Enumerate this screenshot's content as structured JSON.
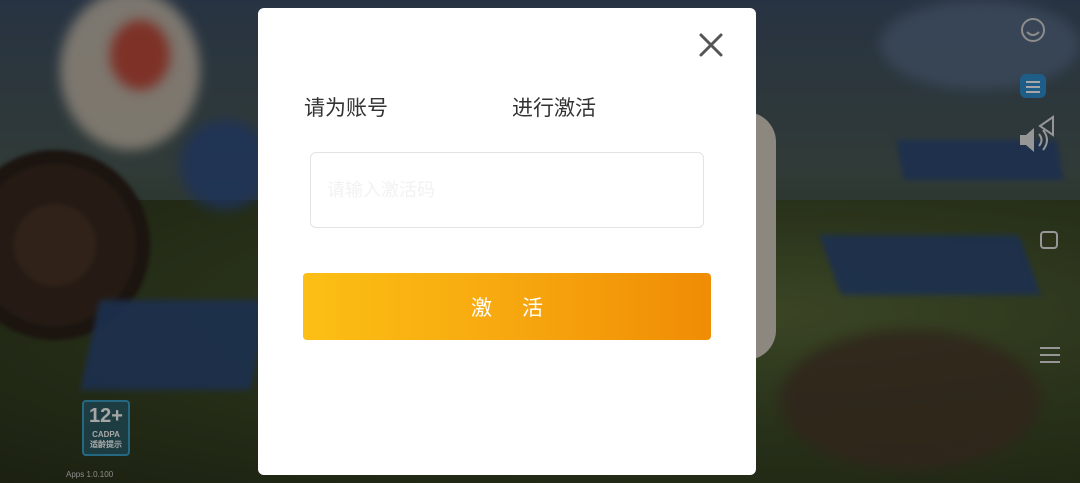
{
  "background": {
    "age_rating": "12+",
    "age_rating_sub": "CADPA",
    "age_rating_note": "适龄提示",
    "version": "Apps 1.0.100"
  },
  "system_nav": {
    "icons": [
      "assistant-icon",
      "menu-icon",
      "back-icon",
      "volume-icon",
      "home-icon",
      "hamburger-icon"
    ]
  },
  "dialog": {
    "close_icon": "close-icon",
    "prompt_prefix": "请为账号",
    "prompt_account": "",
    "prompt_suffix": "进行激活",
    "code_input": {
      "value": "",
      "placeholder": "请输入激活码"
    },
    "activate_label": "激活"
  },
  "colors": {
    "button_start": "#fcbf14",
    "button_end": "#f08c05",
    "dialog_bg": "#ffffff",
    "text": "#333333"
  }
}
